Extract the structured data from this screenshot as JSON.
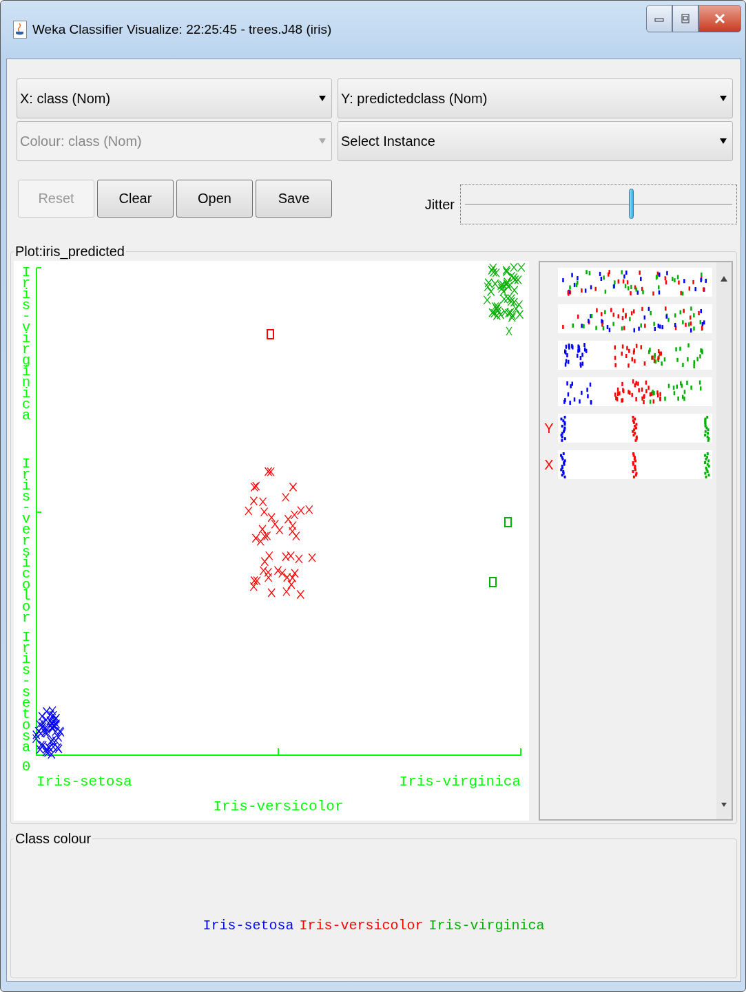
{
  "window": {
    "title": "Weka Classifier Visualize: 22:25:45 - trees.J48 (iris)"
  },
  "selectors": [
    {
      "text": "X: class (Nom)",
      "disabled": false
    },
    {
      "text": "Y: predictedclass (Nom)",
      "disabled": false
    },
    {
      "text": "Colour: class (Nom)",
      "disabled": true
    },
    {
      "text": "Select Instance",
      "disabled": false
    }
  ],
  "buttons": [
    {
      "label": "Reset",
      "disabled": true
    },
    {
      "label": "Clear",
      "disabled": false
    },
    {
      "label": "Open",
      "disabled": false
    },
    {
      "label": "Save",
      "disabled": false
    }
  ],
  "jitter": {
    "label": "Jitter",
    "level": 0.62
  },
  "plot": {
    "title": "Plot:iris_predicted",
    "x_labels": [
      "Iris-setosa",
      "Iris-versicolor",
      "Iris-virginica"
    ],
    "y_labels": [
      "Iris-virginica",
      "Iris-versicolor",
      "Iris-setosa"
    ],
    "y_origin": "0"
  },
  "attribute_panel": {
    "axis_markers": [
      "Y",
      "X"
    ]
  },
  "class_colour": {
    "title": "Class colour",
    "classes": [
      {
        "name": "Iris-setosa",
        "color": "#0000ff"
      },
      {
        "name": "Iris-versicolor",
        "color": "#ff0000"
      },
      {
        "name": "Iris-virginica",
        "color": "#00b000"
      }
    ]
  }
}
